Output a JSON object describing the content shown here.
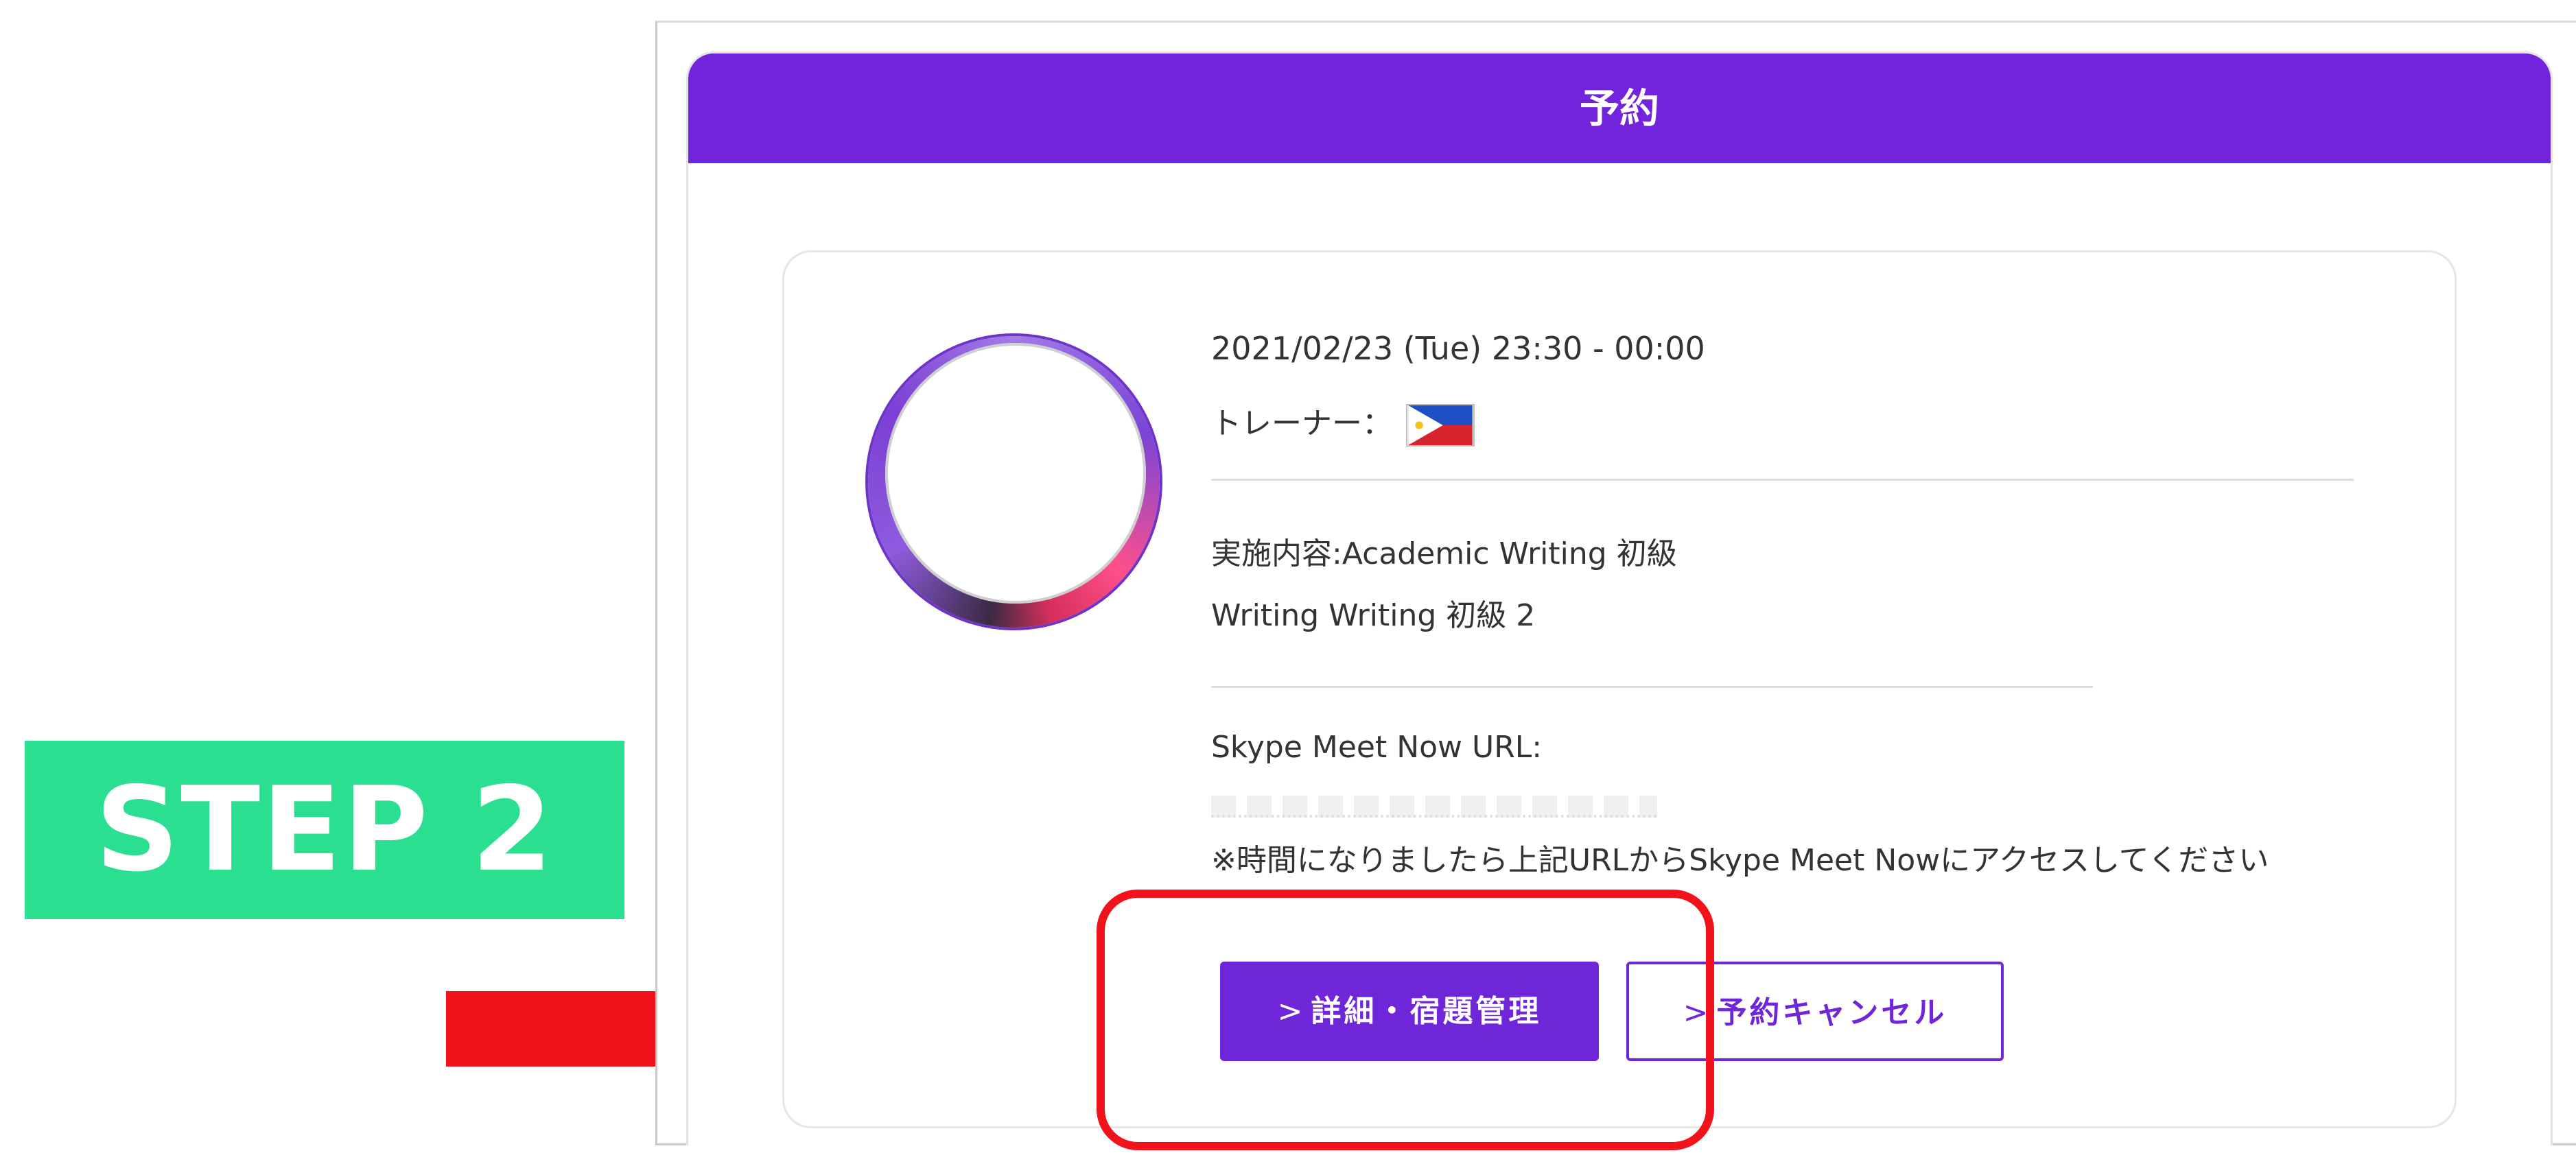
{
  "annotation": {
    "step_label": "STEP 2"
  },
  "panel": {
    "title": "予約"
  },
  "reservation": {
    "datetime": "2021/02/23 (Tue) 23:30 - 00:00",
    "trainer_label": "トレーナー：",
    "trainer_flag": "philippines-flag-icon",
    "content_line": "実施内容:Academic Writing 初級",
    "course_line": "Writing Writing 初級 2",
    "skype_label": "Skype Meet Now URL:",
    "note": "※時間になりましたら上記URLからSkype Meet Nowにアクセスしてください"
  },
  "buttons": {
    "chevron": ">",
    "detail_label": "詳細・宿題管理",
    "cancel_label": "予約キャンセル"
  },
  "colors": {
    "brand_purple": "#7224dc",
    "step_green": "#2adf90",
    "annotation_red": "#f2121b"
  }
}
